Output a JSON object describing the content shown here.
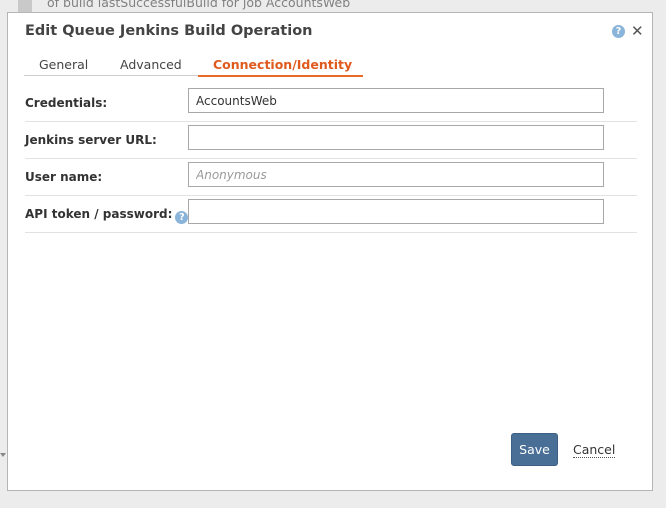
{
  "background": {
    "job_text": "of build lastSuccessfulBuild for job AccountsWeb"
  },
  "dialog": {
    "title": "Edit Queue Jenkins Build Operation",
    "help_icon": "question-circle-icon",
    "close_icon": "close-x-icon",
    "close_glyph": "✕",
    "help_glyph": "?"
  },
  "tabs": [
    {
      "label": "General",
      "active": false
    },
    {
      "label": "Advanced",
      "active": false
    },
    {
      "label": "Connection/Identity",
      "active": true
    }
  ],
  "form": {
    "credentials": {
      "label": "Credentials:",
      "value": "AccountsWeb",
      "placeholder": ""
    },
    "server_url": {
      "label": "Jenkins server URL:",
      "value": "",
      "placeholder": ""
    },
    "user_name": {
      "label": "User name:",
      "value": "",
      "placeholder": "Anonymous"
    },
    "api_token": {
      "label": "API token / password:",
      "value": "",
      "placeholder": ""
    }
  },
  "buttons": {
    "save_label": "Save",
    "cancel_label": "Cancel"
  },
  "colors": {
    "active_tab": "#e05a1e",
    "save_button": "#4a6f96",
    "help_icon": "#8ab4d9"
  }
}
